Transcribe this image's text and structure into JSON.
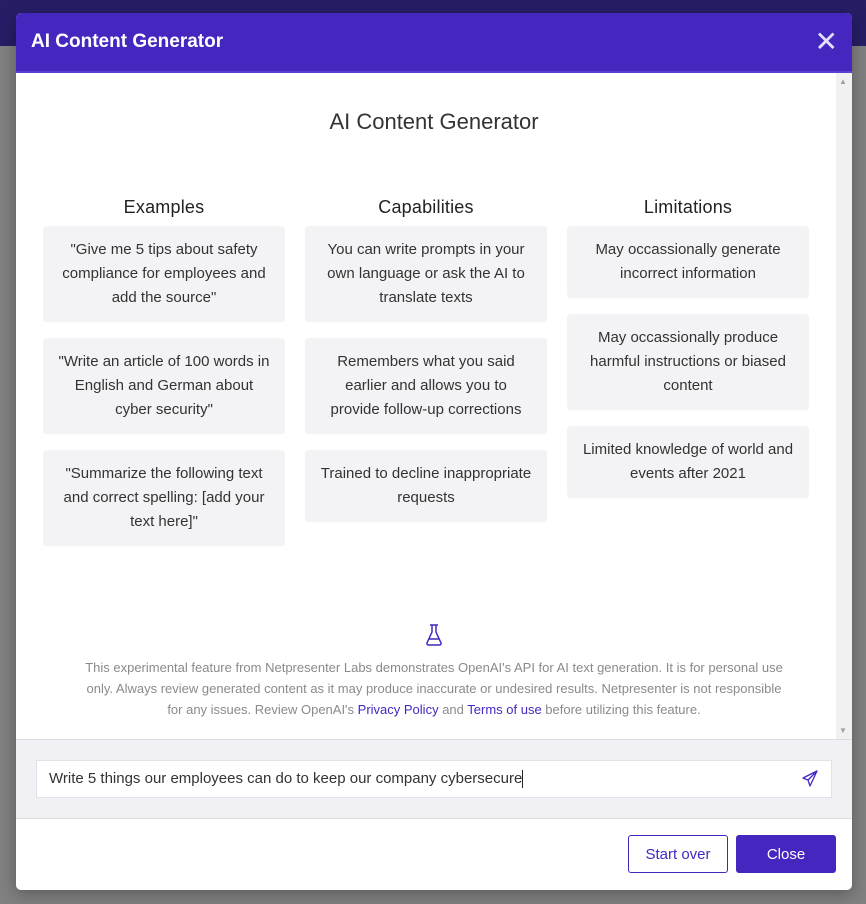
{
  "modal": {
    "title": "AI Content Generator",
    "close_icon": "close-icon"
  },
  "content": {
    "title": "AI Content Generator",
    "columns": [
      {
        "heading": "Examples",
        "items": [
          "\"Give me 5 tips about safety compliance for employees and add the source\"",
          "\"Write an article of 100 words in English and German about cyber security\"",
          "\"Summarize the following text and correct spelling: [add your text here]\""
        ]
      },
      {
        "heading": "Capabilities",
        "items": [
          "You can write prompts in your own language or ask the AI to translate texts",
          "Remembers what you said earlier and allows you to provide follow-up corrections",
          "Trained to decline inappropriate requests"
        ]
      },
      {
        "heading": "Limitations",
        "items": [
          "May occassionally generate incorrect information",
          "May occassionally produce harmful instructions or biased content",
          "Limited knowledge of world and events after 2021"
        ]
      }
    ],
    "disclaimer": {
      "part1": "This experimental feature from Netpresenter Labs demonstrates OpenAI's API for AI text generation. It is for personal use only. Always review generated content as it may produce inaccurate or undesired results. Netpresenter is not responsible for any issues. Review OpenAI's ",
      "privacy_link": "Privacy Policy",
      "part2": " and ",
      "terms_link": "Terms of use",
      "part3": " before utilizing this feature."
    }
  },
  "prompt": {
    "value": "Write 5 things our employees can do to keep our company cybersecure",
    "send_icon": "send-icon"
  },
  "footer": {
    "start_over": "Start over",
    "close": "Close"
  },
  "colors": {
    "accent": "#4527c0",
    "overlay_top": "#271d66"
  }
}
